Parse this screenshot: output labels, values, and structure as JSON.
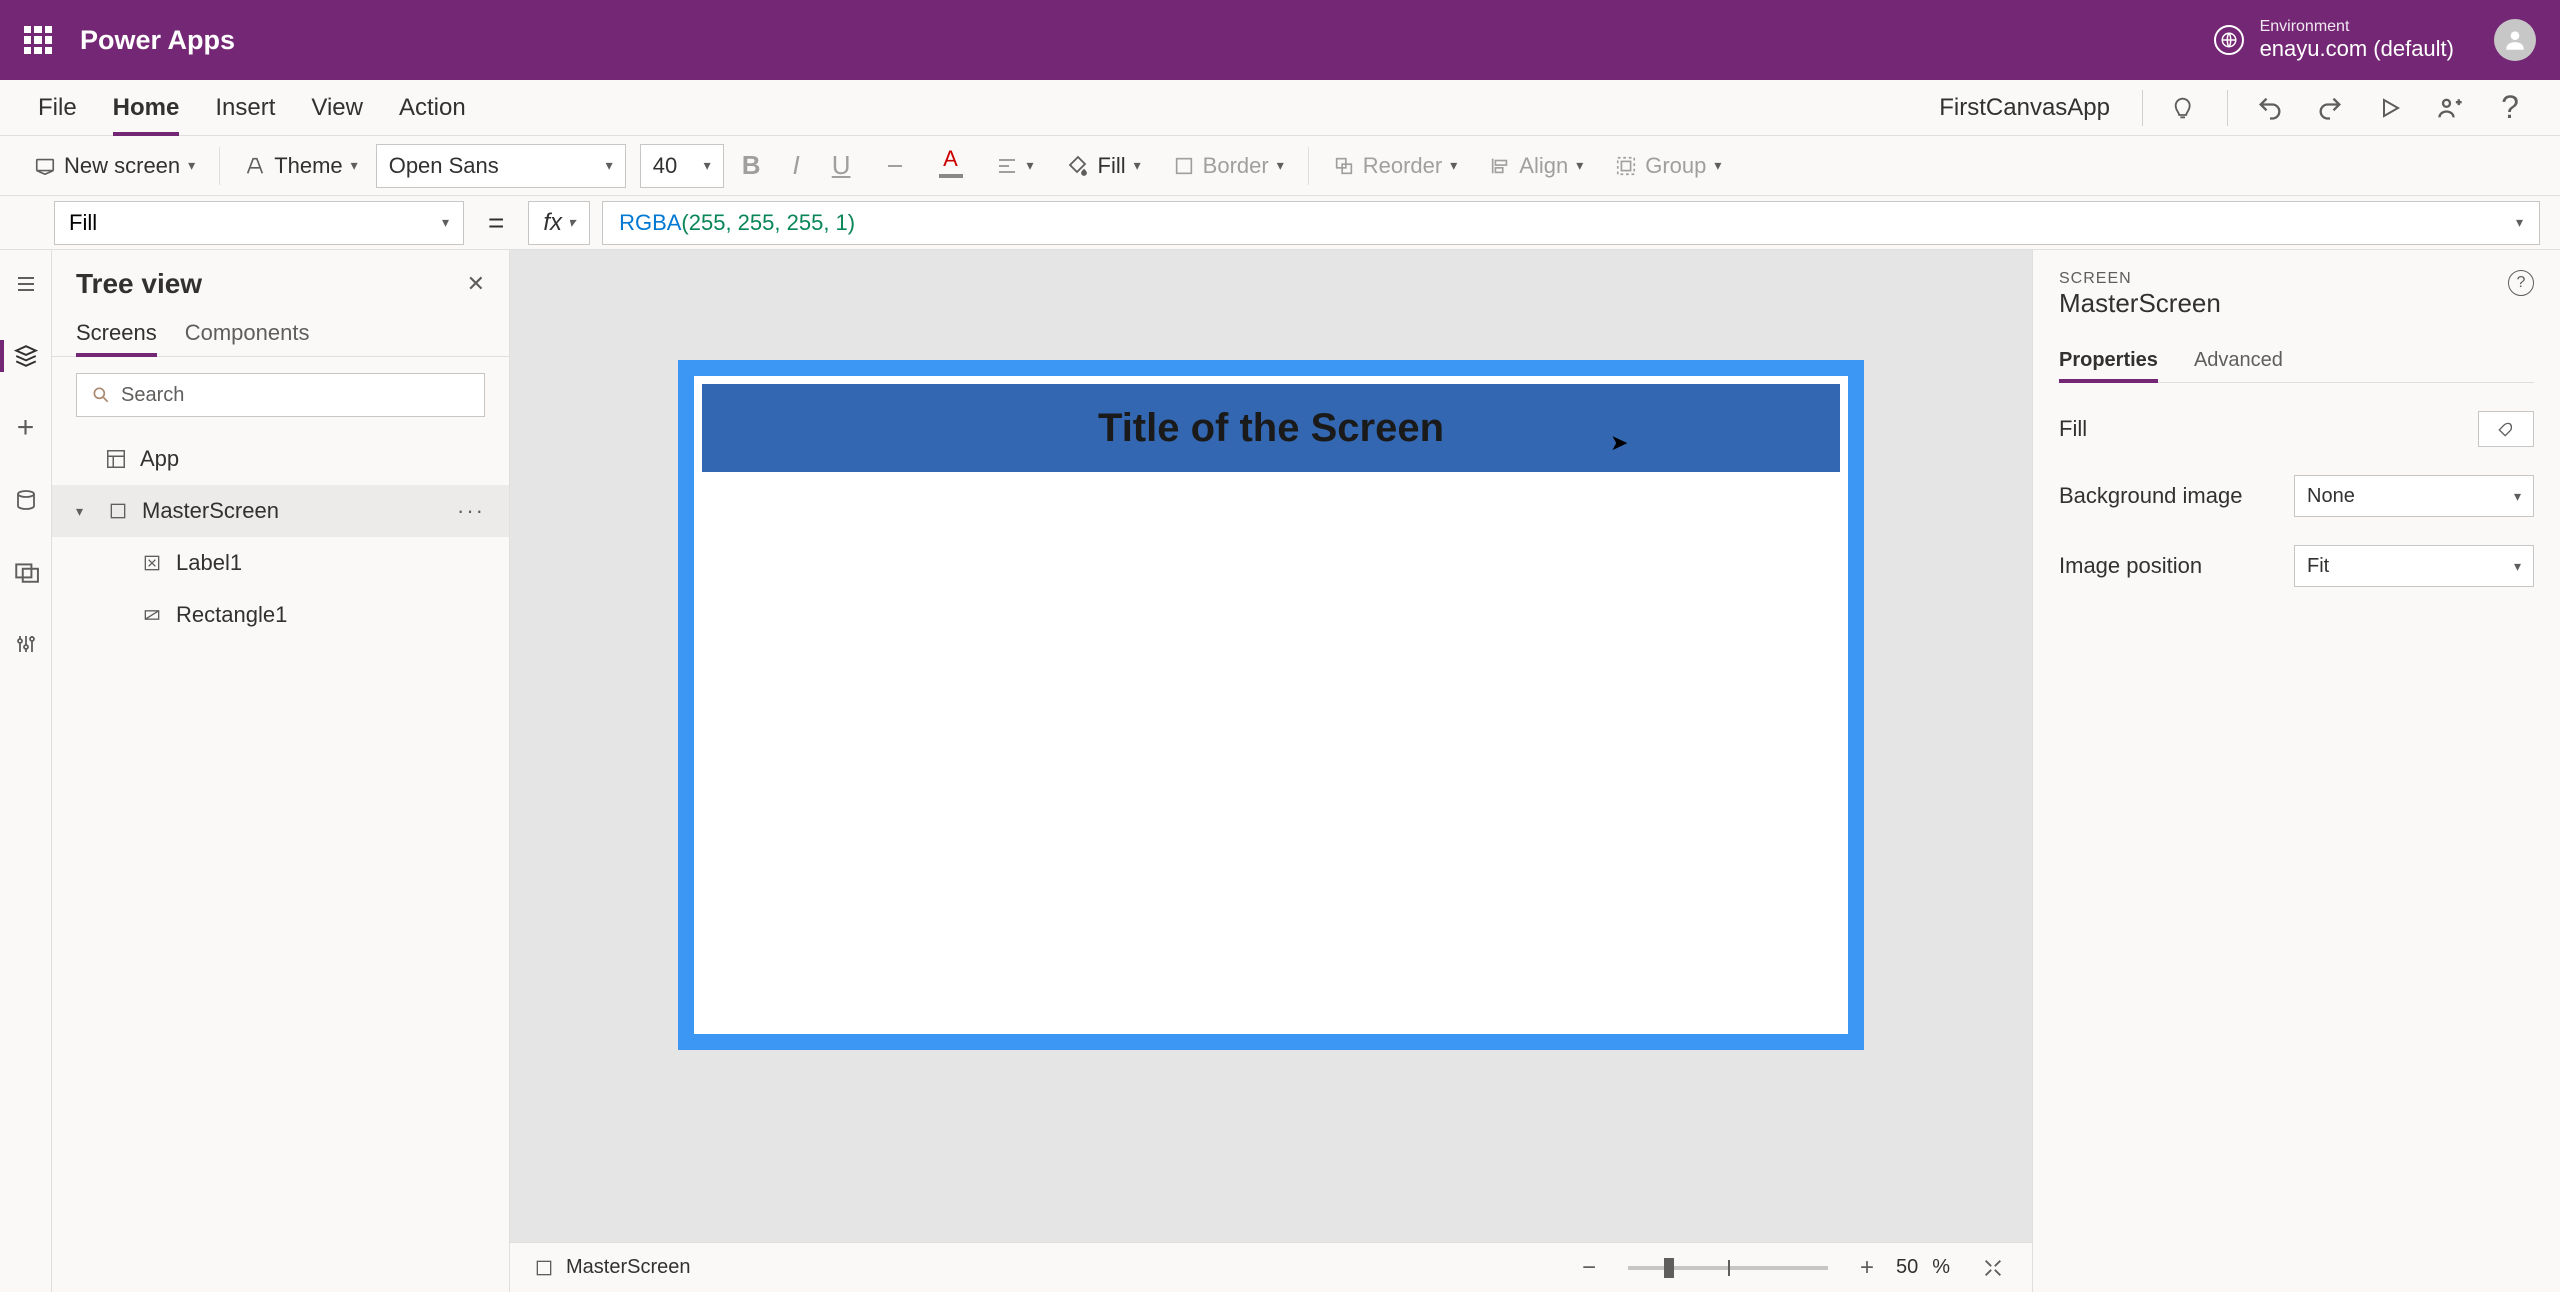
{
  "header": {
    "app_title": "Power Apps",
    "env_label": "Environment",
    "env_name": "enayu.com (default)"
  },
  "menu": {
    "items": [
      "File",
      "Home",
      "Insert",
      "View",
      "Action"
    ],
    "active": "Home",
    "app_name": "FirstCanvasApp"
  },
  "ribbon": {
    "new_screen": "New screen",
    "theme": "Theme",
    "font": "Open Sans",
    "font_size": "40",
    "fill": "Fill",
    "border": "Border",
    "reorder": "Reorder",
    "align": "Align",
    "group": "Group"
  },
  "formula": {
    "property": "Fill",
    "fx": "fx",
    "func": "RGBA",
    "args": "(255, 255, 255, 1)"
  },
  "tree": {
    "title": "Tree view",
    "tabs": [
      "Screens",
      "Components"
    ],
    "active_tab": "Screens",
    "search_placeholder": "Search",
    "items": {
      "app": "App",
      "master": "MasterScreen",
      "label": "Label1",
      "rect": "Rectangle1"
    }
  },
  "canvas": {
    "title_text": "Title of the Screen",
    "footer_name": "MasterScreen",
    "zoom": "50",
    "zoom_pct": "%"
  },
  "props": {
    "section": "SCREEN",
    "name": "MasterScreen",
    "tabs": [
      "Properties",
      "Advanced"
    ],
    "active_tab": "Properties",
    "fill_label": "Fill",
    "bg_image_label": "Background image",
    "bg_image_value": "None",
    "img_pos_label": "Image position",
    "img_pos_value": "Fit"
  }
}
